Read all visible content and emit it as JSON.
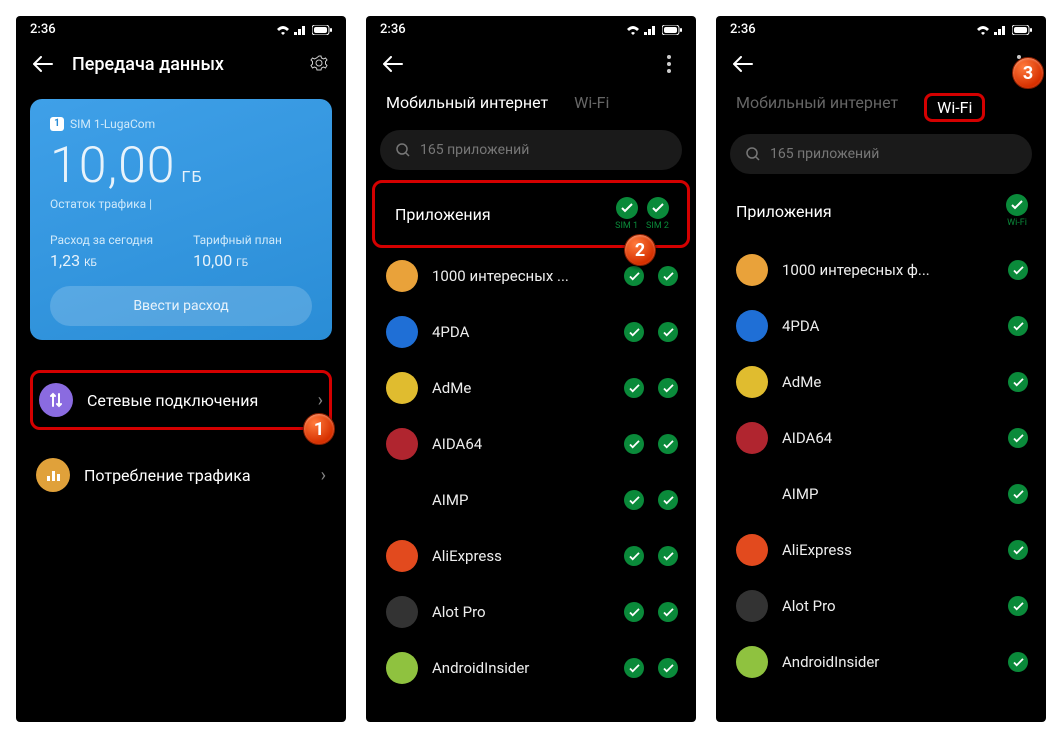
{
  "statusbar_time": "2:36",
  "screen1": {
    "title": "Передача данных",
    "sim_label": "SIM 1-LugaCom",
    "balance_value": "10,00",
    "balance_unit": "ГБ",
    "balance_sub": "Остаток трафика |",
    "today_label": "Расход за сегодня",
    "today_value": "1,23",
    "today_unit": "КБ",
    "plan_label": "Тарифный план",
    "plan_value": "10,00",
    "plan_unit": "ГБ",
    "btn": "Ввести расход",
    "menu1": "Сетевые подключения",
    "menu2": "Потребление трафика"
  },
  "tabs": {
    "mobile": "Мобильный интернет",
    "wifi": "Wi-Fi"
  },
  "search_placeholder": "165 приложений",
  "list_header": "Приложения",
  "col_sim1": "SIM 1",
  "col_sim2": "SIM 2",
  "col_wifi": "Wi-Fi",
  "apps": [
    {
      "name": "1000 интересных ф...",
      "name_s2": "1000 интересных ...",
      "bg": "#e9a23a"
    },
    {
      "name": "4PDA",
      "bg": "#1f6fd6"
    },
    {
      "name": "AdMe",
      "bg": "#e0bc2f"
    },
    {
      "name": "AIDA64",
      "bg": "#b0252f"
    },
    {
      "name": "AIMP",
      "bg": "#000"
    },
    {
      "name": "AliExpress",
      "bg": "#e24a1e"
    },
    {
      "name": "Alot Pro",
      "bg": "#333"
    },
    {
      "name": "AndroidInsider",
      "bg": "#8fc23f"
    }
  ],
  "badges": {
    "b1": "1",
    "b2": "2",
    "b3": "3"
  }
}
